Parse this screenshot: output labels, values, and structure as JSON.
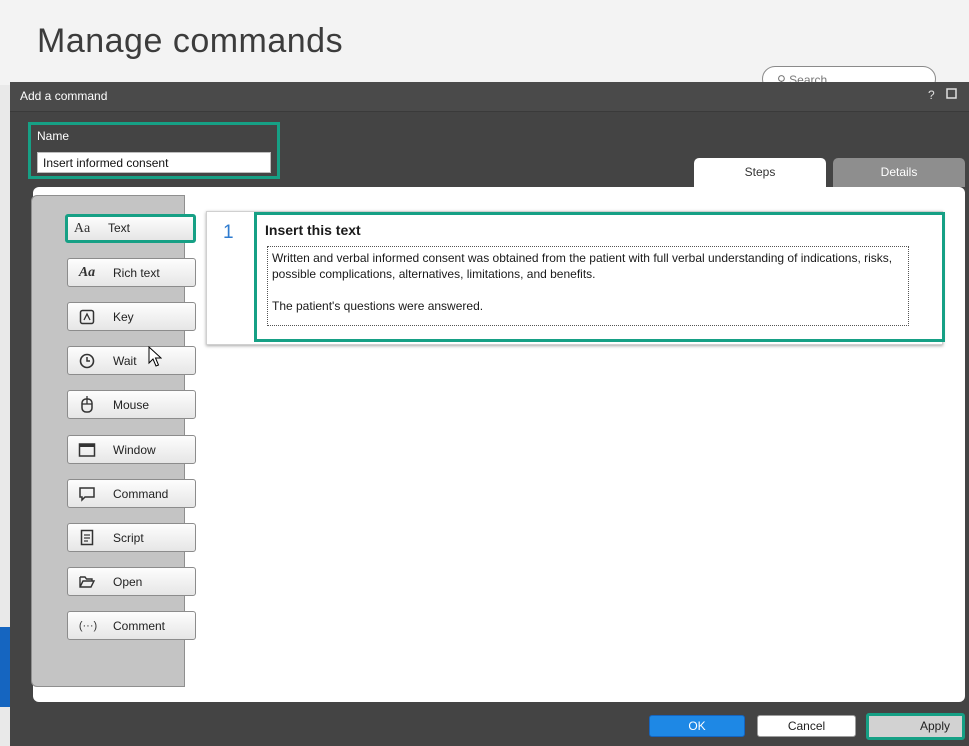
{
  "background": {
    "page_title": "Manage commands",
    "search_placeholder": "Search"
  },
  "dialog": {
    "title": "Add a command",
    "help_label": "?",
    "name": {
      "label": "Name",
      "value": "Insert informed consent"
    },
    "tabs": [
      {
        "label": "Steps",
        "active": true
      },
      {
        "label": "Details",
        "active": false
      }
    ],
    "step_types": [
      {
        "label": "Text",
        "icon": "text-aa-icon"
      },
      {
        "label": "Rich text",
        "icon": "rich-text-aa-icon"
      },
      {
        "label": "Key",
        "icon": "key-icon"
      },
      {
        "label": "Wait",
        "icon": "clock-icon"
      },
      {
        "label": "Mouse",
        "icon": "mouse-icon"
      },
      {
        "label": "Window",
        "icon": "window-icon"
      },
      {
        "label": "Command",
        "icon": "speech-bubble-icon"
      },
      {
        "label": "Script",
        "icon": "script-icon"
      },
      {
        "label": "Open",
        "icon": "folder-open-icon"
      },
      {
        "label": "Comment",
        "icon": "comment-ellipsis-icon"
      }
    ],
    "steps": [
      {
        "number": "1",
        "title": "Insert this text",
        "text": "Written and verbal informed consent was obtained from the patient with full verbal understanding of indications, risks, possible complications, alternatives, limitations, and benefits.\n\nThe patient's questions were answered."
      }
    ],
    "buttons": {
      "ok": "OK",
      "cancel": "Cancel",
      "apply": "Apply"
    }
  },
  "colors": {
    "highlight": "#16a085",
    "accent_blue": "#1e88e5",
    "dialog_bg": "#444444"
  }
}
